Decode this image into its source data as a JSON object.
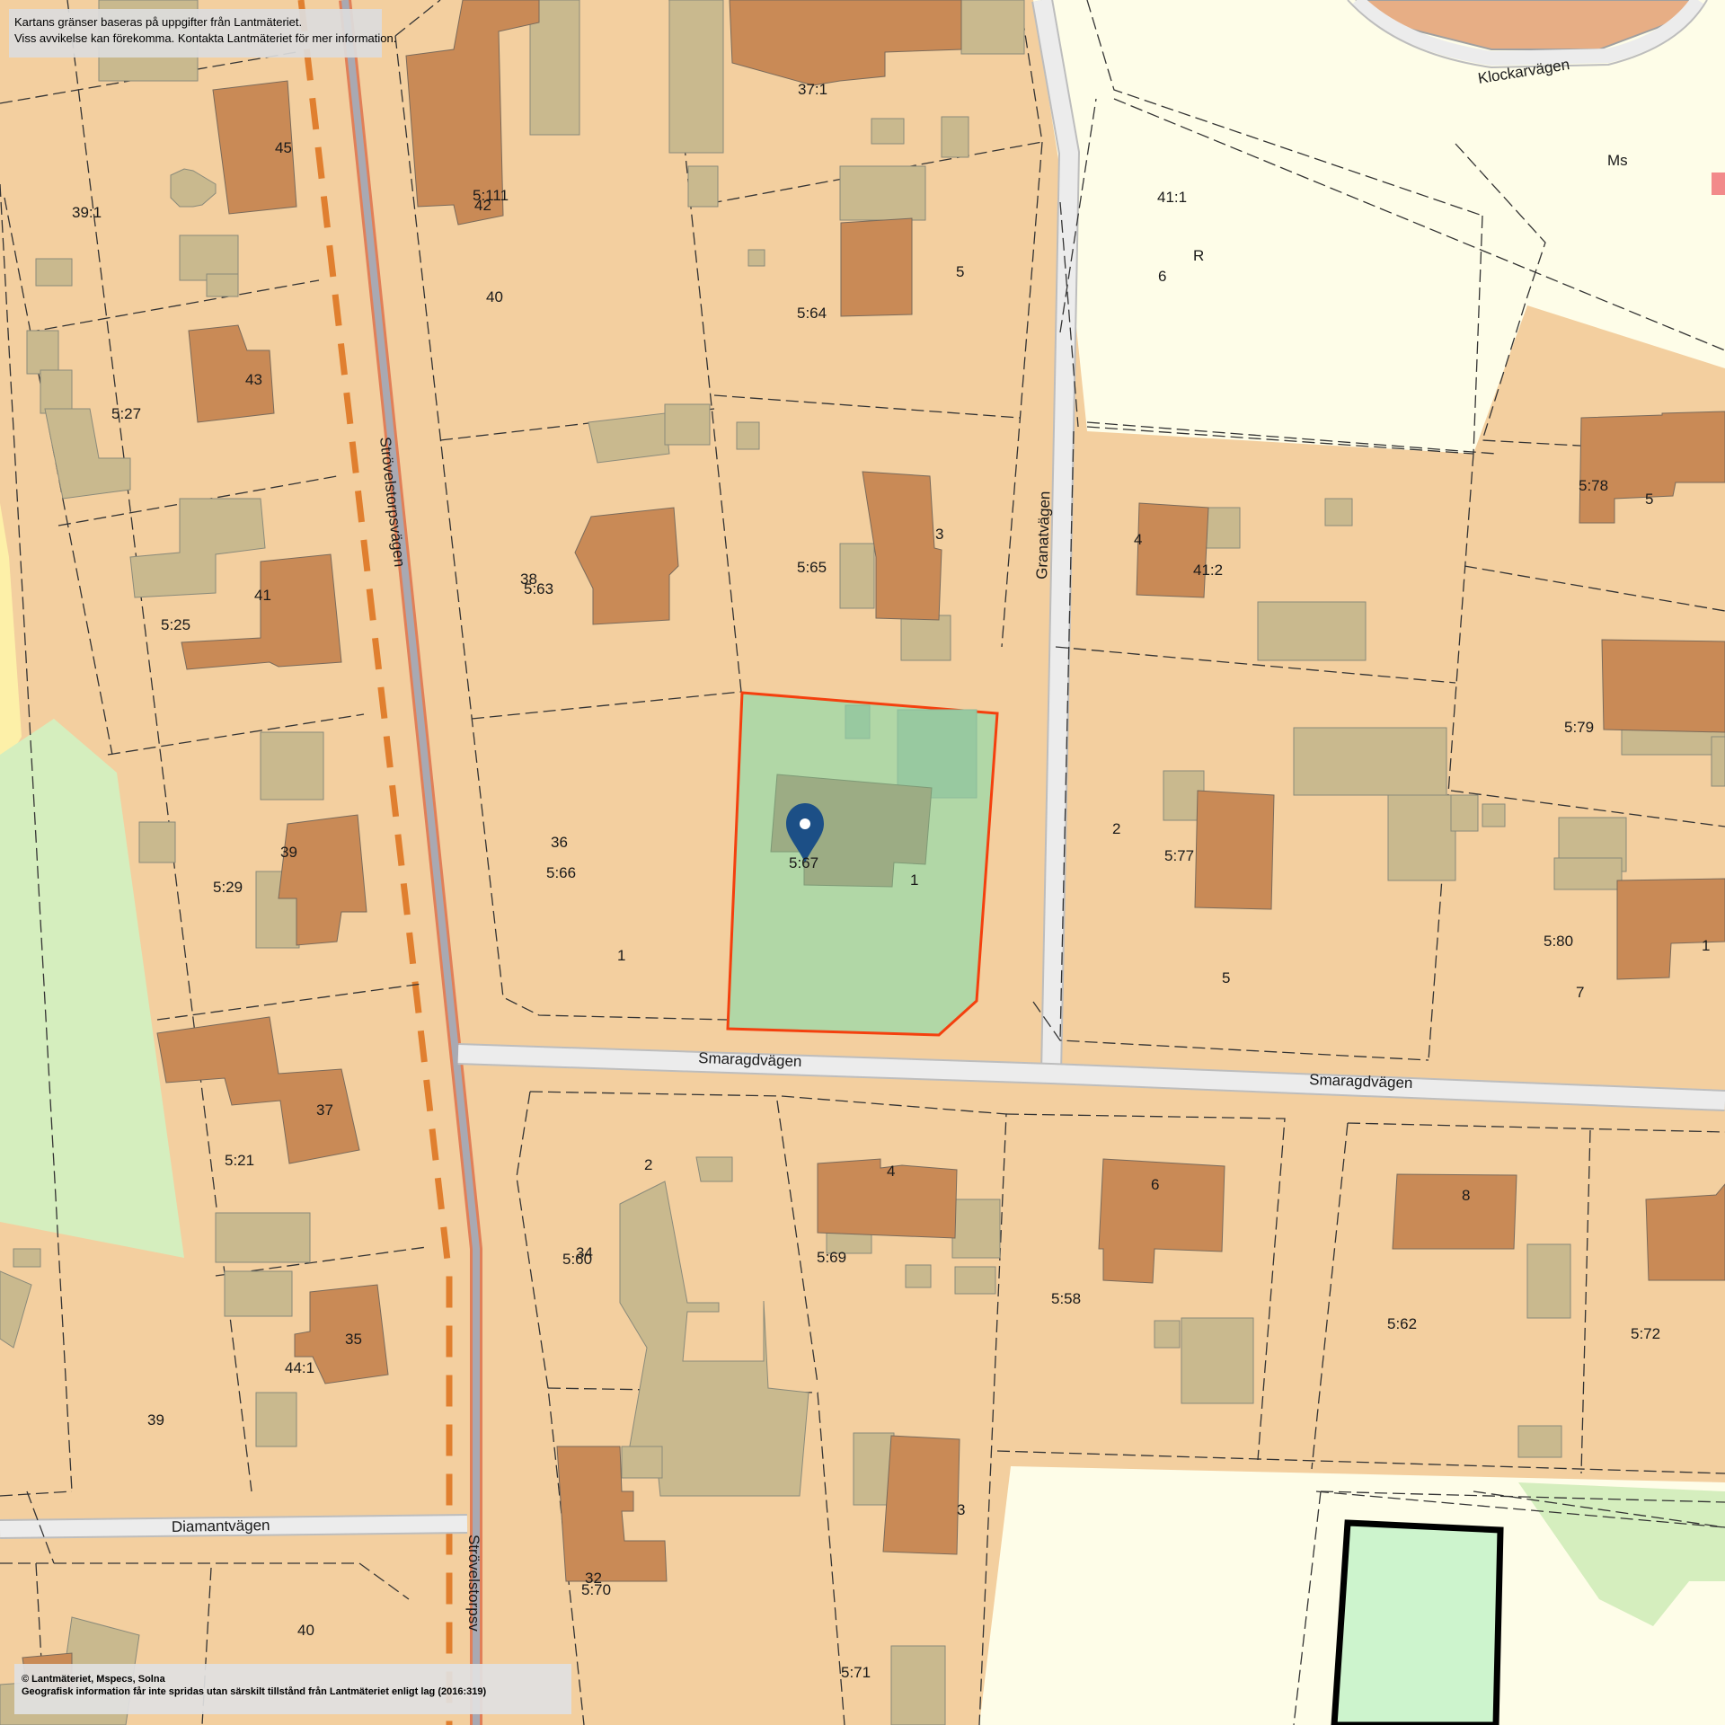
{
  "notice": {
    "line1": "Kartans gränser baseras på uppgifter från Lantmäteriet.",
    "line2": "Viss avvikelse kan förekomma. Kontakta Lantmäteriet för mer information."
  },
  "copyright": {
    "line1": "© Lantmäteriet, Mspecs, Solna",
    "line2": "Geografisk information får inte spridas utan särskilt tillstånd från Lantmäteriet enligt lag (2016:319)"
  },
  "roads": {
    "strovelstorp_upper": "Strövelstorpsvägen",
    "strovelstorp_lower": "Strövelstorpsv",
    "granat": "Granatvägen",
    "smaragd_west": "Smaragdvägen",
    "smaragd_east": "Smaragdvägen",
    "diamant": "Diamantvägen",
    "klockar": "Klockarvägen"
  },
  "parcel_labels": {
    "p_37_1": "37:1",
    "p_45": "45",
    "p_39_1": "39:1",
    "p_5_111": "5:111",
    "p_42": "42",
    "p_40_top": "40",
    "p_41_1": "41:1",
    "p_6_top": "6",
    "p_ms": "Ms",
    "p_r": "R",
    "p_5_top": "5",
    "p_5_64": "5:64",
    "p_43": "43",
    "p_5_27": "5:27",
    "p_38": "38",
    "p_5_63": "5:63",
    "p_3_top": "3",
    "p_5_65": "5:65",
    "p_4_right": "4",
    "p_41_2": "41:2",
    "p_5_78": "5:78",
    "p_5_right": "5",
    "p_41": "41",
    "p_5_25": "5:25",
    "p_5_79": "5:79",
    "p_36": "36",
    "p_5_66": "5:66",
    "p_1_mid": "1",
    "p_5_67": "5:67",
    "p_1_sel": "1",
    "p_2_right": "2",
    "p_5_77": "5:77",
    "p_5_mid": "5",
    "p_5_80": "5:80",
    "p_1_far": "1",
    "p_7": "7",
    "p_39": "39",
    "p_5_29": "5:29",
    "p_37": "37",
    "p_5_21": "5:21",
    "p_2_low": "2",
    "p_4_low": "4",
    "p_5_69": "5:69",
    "p_6_low": "6",
    "p_8": "8",
    "p_5_60": "5:60",
    "p_34": "34",
    "p_5_58": "5:58",
    "p_5_62": "5:62",
    "p_5_72": "5:72",
    "p_35": "35",
    "p_44_1": "44:1",
    "p_39_low": "39",
    "p_3_low": "3",
    "p_32": "32",
    "p_5_70": "5:70",
    "p_40_low": "40",
    "p_5_71": "5:71"
  },
  "colors": {
    "land": "#f3cf9f",
    "building_main": "#c98a56",
    "building_secondary": "#c9b98e",
    "road": "#ececec",
    "road_edge": "#b8b8b8",
    "public_area": "#fefde8",
    "green_area": "#d5eebe",
    "selected_fill": "#b1d7a6",
    "selected_border": "#f4400e",
    "pin": "#1c4f86",
    "railway_dash": "#e07f2f"
  },
  "marker": {
    "icon": "location-pin-icon"
  }
}
